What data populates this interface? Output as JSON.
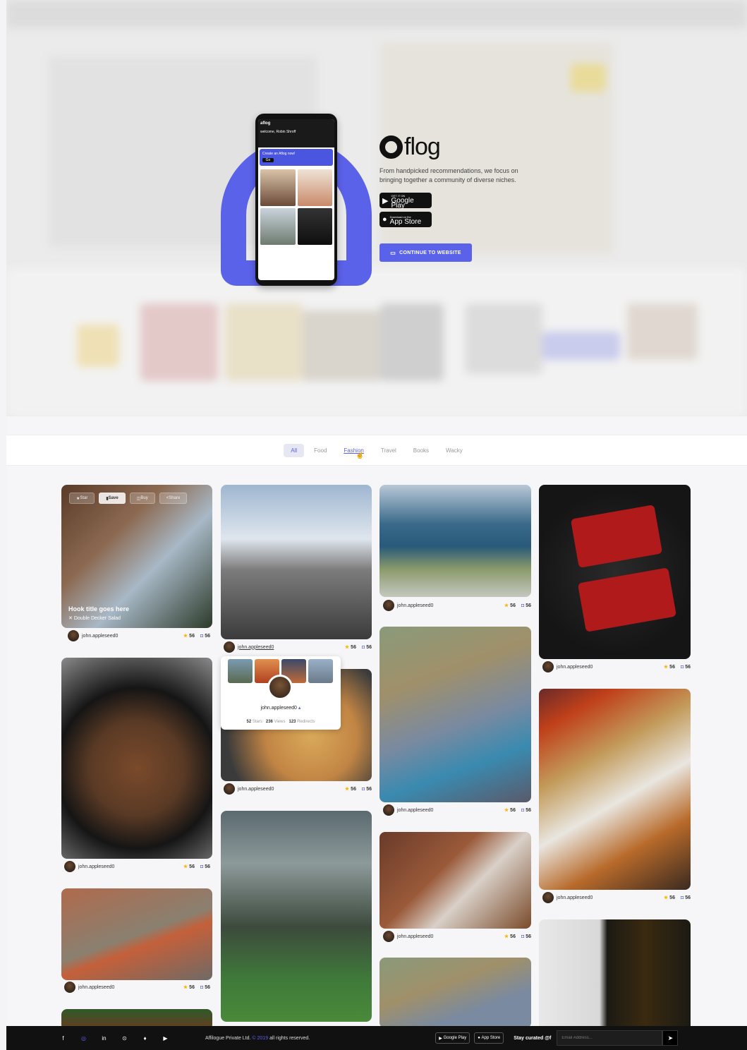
{
  "hero": {
    "brand": "flog",
    "tagline": "From handpicked recommendations, we focus on bringing together a community of diverse niches.",
    "google_play": {
      "small": "GET IT ON",
      "big": "Google Play"
    },
    "app_store": {
      "small": "Download on the",
      "big": "App Store"
    },
    "cta": "CONTINUE TO WEBSITE",
    "phone": {
      "app_name": "aflog",
      "greeting": "welcome, Robin Shroff",
      "banner": "Create an Aflog now!",
      "banner_btn": "Go"
    }
  },
  "tabs": [
    "All",
    "Food",
    "Fashion",
    "Travel",
    "Books",
    "Wacky"
  ],
  "active_tab": "All",
  "feature_card": {
    "actions": [
      "Star",
      "Save",
      "Buy",
      "Share"
    ],
    "hook_title": "Hook title goes here",
    "hook_sub": "Double Decker Salad"
  },
  "post": {
    "username": "john.appleseed0",
    "stars": "56",
    "saves": "56"
  },
  "popover": {
    "username": "john.appleseed0",
    "stars": "52",
    "stars_label": "Stars",
    "views": "236",
    "views_label": "Views",
    "redirects": "123",
    "redirects_label": "Redirects"
  },
  "footer": {
    "company": "Affilogue Private Ltd.",
    "year": "© 2019",
    "rights": "all rights reserved.",
    "gp": "Google Play",
    "as": "App Store",
    "stay": "Stay curated",
    "email_placeholder": "Email Address..."
  },
  "colors": {
    "accent": "#5b62ea",
    "star": "#f5b800",
    "footer_bg": "#111111"
  },
  "icons": [
    "facebook-icon",
    "instagram-icon",
    "linkedin-icon",
    "pinterest-icon",
    "twitter-icon",
    "youtube-icon",
    "send-icon"
  ]
}
